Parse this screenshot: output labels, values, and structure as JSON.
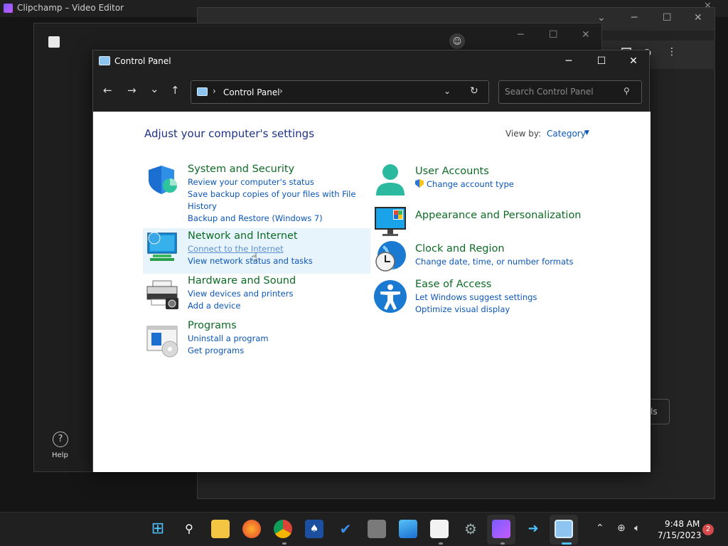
{
  "background": {
    "app_title": "Clipchamp – Video Editor",
    "browser_button_fragment": "ls",
    "help_label": "Help"
  },
  "window": {
    "title": "Control Panel",
    "minimize": "─",
    "maximize": "☐",
    "close": "✕"
  },
  "nav": {
    "back": "←",
    "forward": "→",
    "recent": "⌄",
    "up": "↑",
    "breadcrumb": "Control Panel",
    "search_placeholder": "Search Control Panel"
  },
  "content": {
    "heading": "Adjust your computer's settings",
    "view_by_label": "View by:",
    "view_by_value": "Category",
    "left_categories": [
      {
        "title": "System and Security",
        "icon": "shield-icon",
        "links": [
          "Review your computer's status",
          "Save backup copies of your files with File History",
          "Backup and Restore (Windows 7)"
        ]
      },
      {
        "title": "Network and Internet",
        "icon": "network-icon",
        "links": [
          "Connect to the Internet",
          "View network status and tasks"
        ]
      },
      {
        "title": "Hardware and Sound",
        "icon": "printer-icon",
        "links": [
          "View devices and printers",
          "Add a device"
        ]
      },
      {
        "title": "Programs",
        "icon": "programs-icon",
        "links": [
          "Uninstall a program",
          "Get programs"
        ]
      }
    ],
    "right_categories": [
      {
        "title": "User Accounts",
        "icon": "user-icon",
        "links": [
          "Change account type"
        ]
      },
      {
        "title": "Appearance and Personalization",
        "icon": "monitor-icon",
        "links": []
      },
      {
        "title": "Clock and Region",
        "icon": "clock-globe-icon",
        "links": [
          "Change date, time, or number formats"
        ]
      },
      {
        "title": "Ease of Access",
        "icon": "accessibility-icon",
        "links": [
          "Let Windows suggest settings",
          "Optimize visual display"
        ]
      }
    ]
  },
  "taskbar": {
    "time": "9:48 AM",
    "date": "7/15/2023",
    "notification_count": "2",
    "icons": [
      "start-icon",
      "search-icon",
      "file-explorer-icon",
      "firefox-icon",
      "chrome-icon",
      "solitaire-icon",
      "todo-icon",
      "calculator-icon",
      "photos-icon",
      "store-icon",
      "settings-icon",
      "clipchamp-icon",
      "remote-icon",
      "control-panel-icon"
    ]
  },
  "colors": {
    "category_title": "#0e6b25",
    "link": "#0b56b8",
    "heading": "#1e3287",
    "hover_bg": "#e8f4fc"
  }
}
